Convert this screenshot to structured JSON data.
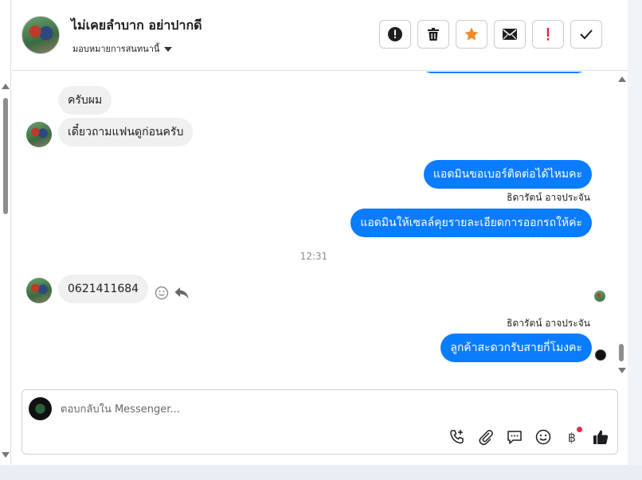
{
  "header": {
    "contact_name": "ไม่เคยลำบาก อย่าปากดี",
    "assign_label": "มอบหมายการสนทนานี้",
    "actions": [
      {
        "name": "report-icon"
      },
      {
        "name": "trash-icon"
      },
      {
        "name": "star-icon"
      },
      {
        "name": "mail-icon"
      },
      {
        "name": "spam-icon"
      },
      {
        "name": "check-icon"
      }
    ]
  },
  "messages": {
    "in_1": "ครับผม",
    "in_2": "เดี๋ยวถามแฟนดูก่อนครับ",
    "out_1": "แอดมินขอเบอร์ติดต่อได้ไหมคะ",
    "sender_1": "ธิดารัตน์ อาจประจัน",
    "out_2": "แอดมินให้เซลล์คุยรายละเอียดการออกรถให้ค่ะ",
    "time": "12:31",
    "in_3": "0621411684",
    "sender_2": "ธิดารัตน์ อาจประจัน",
    "out_3": "ลูกค้าสะดวกรับสายกี่โมงคะ"
  },
  "composer": {
    "placeholder": "ตอบกลับใน Messenger...",
    "baht_symbol": "฿",
    "tools": [
      "phone-icon",
      "attach-icon",
      "saved-reply-icon",
      "emoji-icon",
      "payment-icon",
      "like-icon"
    ]
  },
  "colors": {
    "outgoing": "#0a7cff",
    "incoming": "#f0f0f0",
    "star": "#f08a24",
    "spam": "#e41e3f"
  }
}
